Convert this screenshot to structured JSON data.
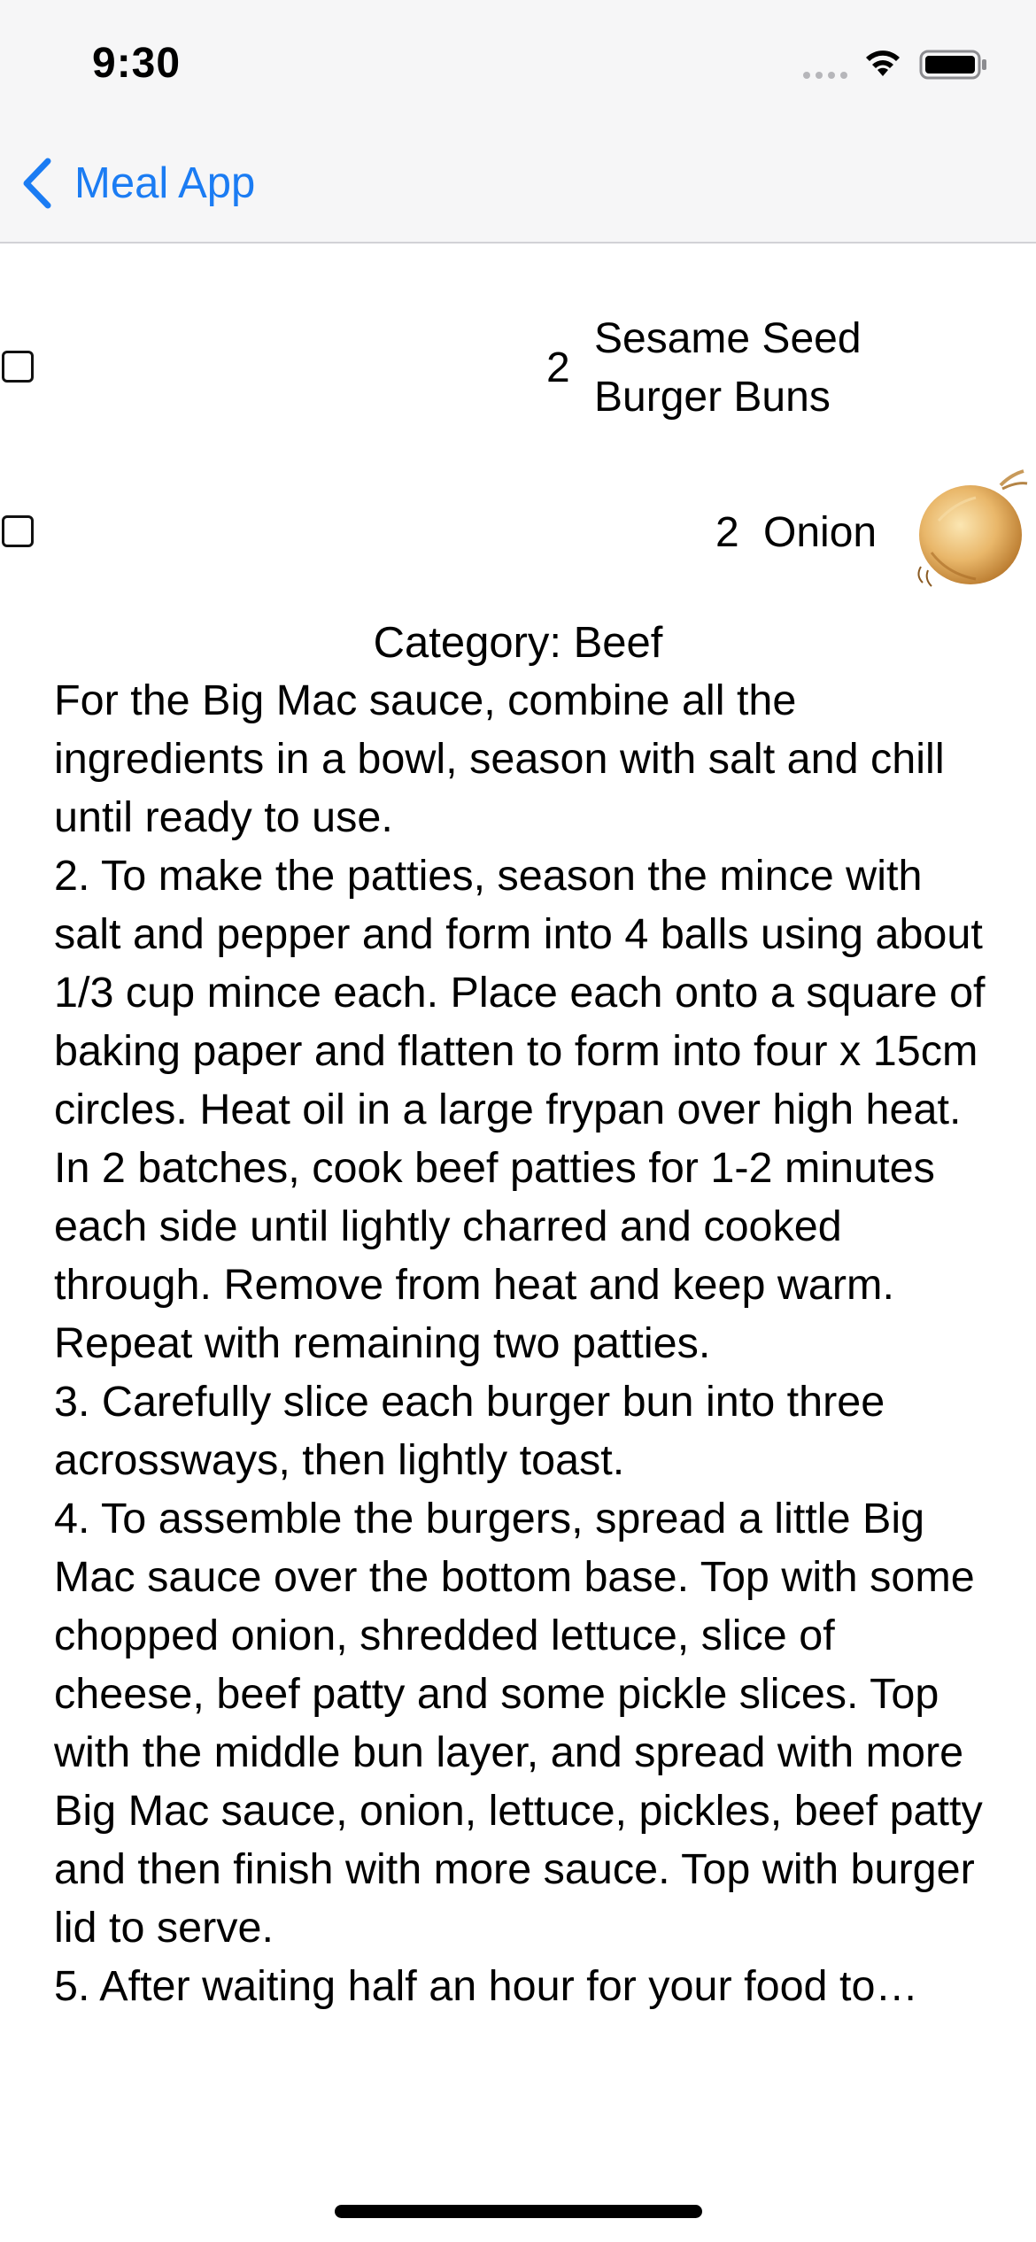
{
  "status_bar": {
    "time": "9:30"
  },
  "nav": {
    "back_label": "Meal App"
  },
  "ingredients": [
    {
      "quantity": "2",
      "name_lines": [
        "Sesame Seed",
        "Burger Buns"
      ]
    },
    {
      "quantity": "2",
      "name": "Onion"
    }
  ],
  "category_text": "Category: Beef",
  "instructions": "For the Big Mac sauce, combine all the ingredients in a bowl, season with salt and chill until ready to use.\n2. To make the patties, season the mince with salt and pepper and form into 4 balls using about 1/3 cup mince each. Place each onto a square of baking paper and flatten to form into four x 15cm circles. Heat oil in a large frypan over high heat. In 2 batches, cook beef patties for 1-2 minutes each side until lightly charred and cooked through. Remove from heat and keep warm. Repeat with remaining two patties.\n3. Carefully slice each burger bun into three acrossways, then lightly toast.\n4. To assemble the burgers, spread a little Big Mac sauce over the bottom base. Top with some chopped onion, shredded lettuce, slice of cheese, beef patty and some pickle slices. Top with the middle bun layer, and spread with more Big Mac sauce, onion, lettuce, pickles, beef patty and then finish with more sauce. Top with burger lid to serve.\n5. After waiting half an hour for your food to…",
  "icons": {
    "back": "chevron-left-icon",
    "signal": "cellular-signal-icon",
    "wifi": "wifi-icon",
    "battery": "battery-icon"
  },
  "colors": {
    "accent": "#1b7cf3",
    "nav_background": "#f6f6f7",
    "text": "#000000"
  }
}
